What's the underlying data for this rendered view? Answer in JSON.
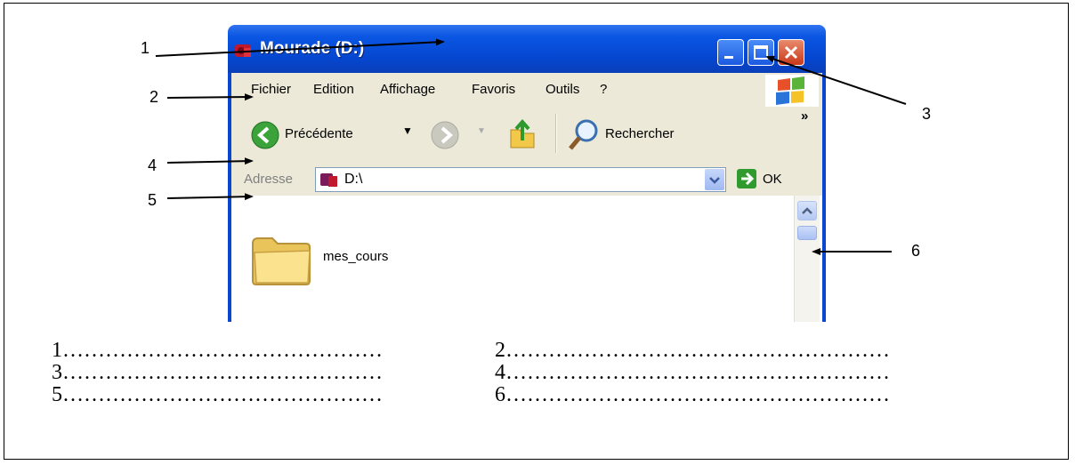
{
  "window": {
    "title": "Mourade  (D:)",
    "menu": [
      "Fichier",
      "Edition",
      "Affichage",
      "Favoris",
      "Outils",
      "?"
    ],
    "toolbar": {
      "back_label": "Précédente",
      "search_label": "Rechercher",
      "more": "»"
    },
    "address": {
      "label": "Adresse",
      "value": "D:\\",
      "go_label": "OK"
    },
    "folder": {
      "name": "mes_cours"
    }
  },
  "callouts": [
    "1",
    "2",
    "3",
    "4",
    "5",
    "6"
  ],
  "answers": [
    [
      "1………………………………………",
      "2………………………………………………"
    ],
    [
      "3………………………………………",
      "4………………………………………………"
    ],
    [
      "5………………………………………",
      "6………………………………………………"
    ]
  ],
  "colors": {
    "titlebar": "#0546d0",
    "close": "#c8391a",
    "chrome": "#ece9d8"
  }
}
